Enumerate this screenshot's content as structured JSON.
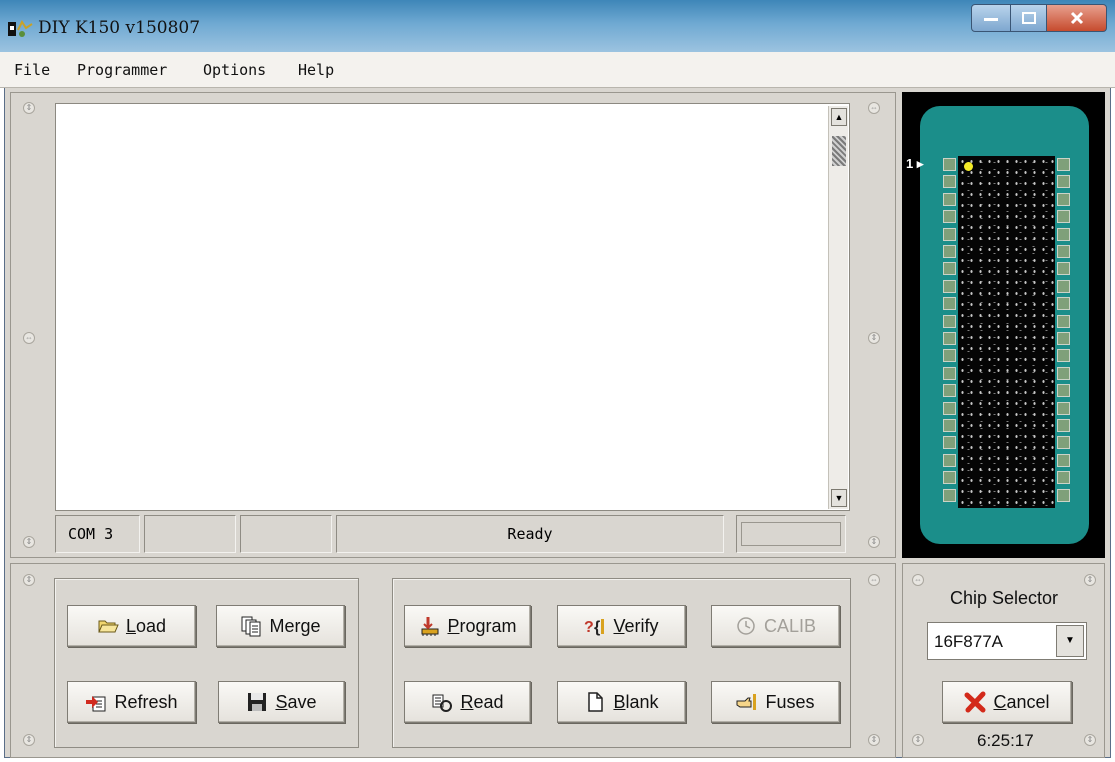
{
  "window": {
    "title": "DIY K150 v150807"
  },
  "menu": {
    "items": [
      "File",
      "Programmer",
      "Options",
      "Help"
    ]
  },
  "status": {
    "port": "COM 3",
    "pane2": "",
    "pane3": "",
    "message": "Ready",
    "progress": 0
  },
  "chip": {
    "pin1_label": "1",
    "pins_per_side": 20
  },
  "buttons": {
    "load": {
      "prefix": "",
      "accel": "L",
      "rest": "oad",
      "icon": "folder-open-icon"
    },
    "merge": {
      "prefix": "Merge",
      "accel": "",
      "rest": "",
      "icon": "merge-docs-icon"
    },
    "refresh": {
      "prefix": "Refresh",
      "accel": "",
      "rest": "",
      "icon": "refresh-arrow-icon"
    },
    "save": {
      "prefix": "",
      "accel": "S",
      "rest": "ave",
      "icon": "floppy-disk-icon"
    },
    "program": {
      "prefix": "",
      "accel": "P",
      "rest": "rogram",
      "icon": "program-chip-icon"
    },
    "verify": {
      "prefix": "",
      "accel": "V",
      "rest": "erify",
      "icon": "verify-icon"
    },
    "calib": {
      "prefix": "CALIB",
      "accel": "",
      "rest": "",
      "icon": "clock-icon"
    },
    "read": {
      "prefix": "",
      "accel": "R",
      "rest": "ead",
      "icon": "read-chip-icon"
    },
    "blank": {
      "prefix": "",
      "accel": "B",
      "rest": "lank",
      "icon": "blank-page-icon"
    },
    "fuses": {
      "prefix": "Fuses",
      "accel": "",
      "rest": "",
      "icon": "fuses-hand-icon"
    },
    "cancel": {
      "prefix": "",
      "accel": "C",
      "rest": "ancel",
      "icon": "red-x-icon"
    }
  },
  "chip_selector": {
    "label": "Chip Selector",
    "value": "16F877A"
  },
  "clock": "6:25:17",
  "colors": {
    "socket": "#1b8e8a",
    "pin": "#7fa07a",
    "pin1_dot": "#f3ea28",
    "cancel_x": "#d32a1a",
    "program_red": "#c0392b"
  }
}
